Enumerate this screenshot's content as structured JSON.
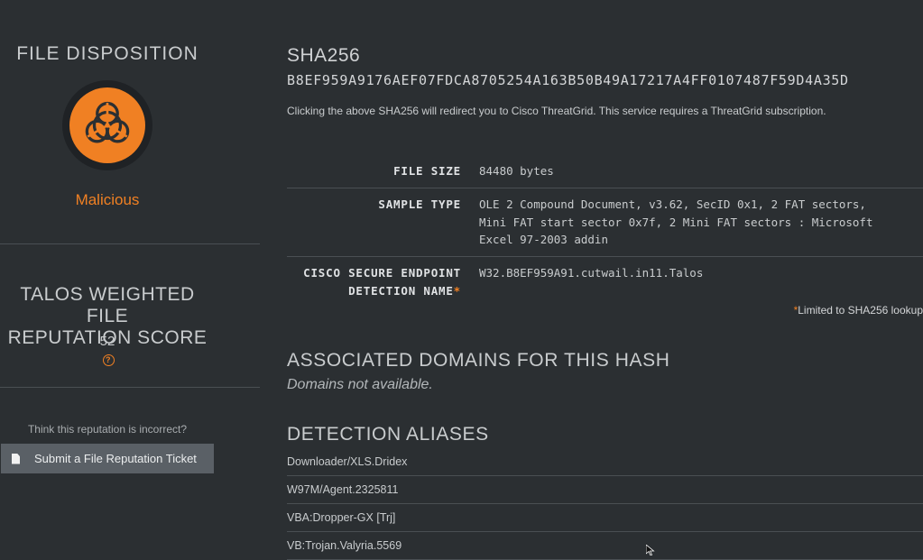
{
  "sidebar": {
    "disposition_title": "FILE DISPOSITION",
    "disposition_icon": "biohazard-icon",
    "disposition_value": "Malicious",
    "score_title_line1": "TALOS WEIGHTED FILE",
    "score_title_line2": "REPUTATION SCORE",
    "score_value": "52",
    "incorrect_prompt": "Think this reputation is incorrect?",
    "ticket_button": "Submit a File Reputation Ticket"
  },
  "main": {
    "sha_label": "SHA256",
    "sha_value": "B8EF959A9176AEF07FDCA8705254A163B50B49A17217A4FF0107487F59D4A35D",
    "sha_note": "Clicking the above SHA256 will redirect you to Cisco ThreatGrid. This service requires a ThreatGrid subscription.",
    "details": [
      {
        "key": "FILE SIZE",
        "value": "84480 bytes"
      },
      {
        "key": "SAMPLE TYPE",
        "value": "OLE 2 Compound Document, v3.62, SecID 0x1, 2 FAT sectors,\nMini FAT start sector 0x7f, 2 Mini FAT sectors : Microsoft\nExcel 97-2003 addin"
      },
      {
        "key_line1": "CISCO SECURE ENDPOINT",
        "key_line2": "DETECTION NAME",
        "asterisk": "*",
        "value": "W32.B8EF959A91.cutwail.in11.Talos"
      }
    ],
    "limited_asterisk": "*",
    "limited_note": "Limited to SHA256 lookup",
    "domains_title": "ASSOCIATED DOMAINS FOR THIS HASH",
    "domains_note": "Domains not available.",
    "aliases_title": "DETECTION ALIASES",
    "aliases": [
      "Downloader/XLS.Dridex",
      "W97M/Agent.2325811",
      "VBA:Dropper-GX [Trj]",
      "VB:Trojan.Valyria.5569"
    ]
  },
  "colors": {
    "background": "#2b2f32",
    "accent": "#f08023",
    "button": "#5a6066"
  }
}
